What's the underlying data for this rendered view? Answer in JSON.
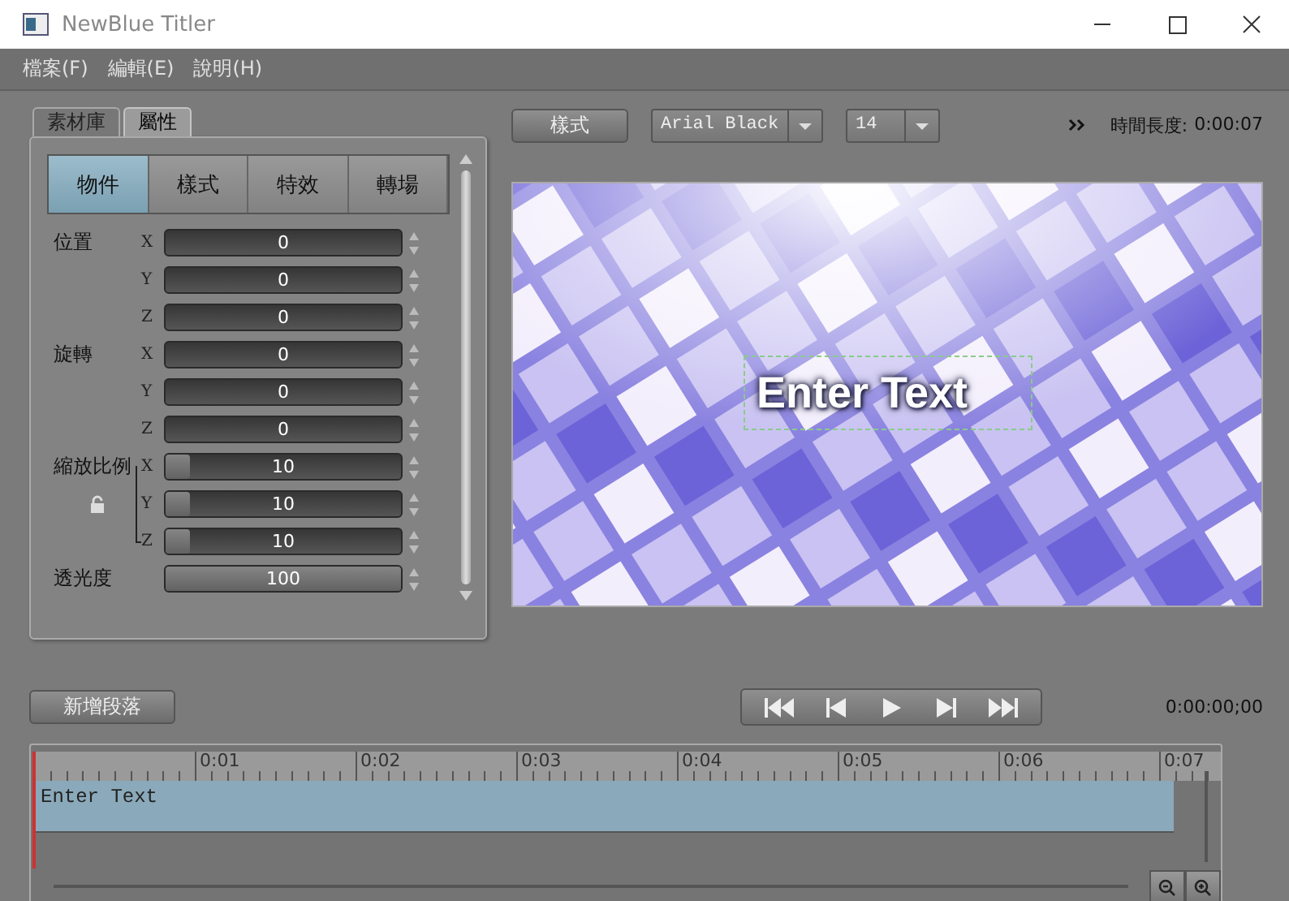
{
  "window": {
    "title": "NewBlue Titler"
  },
  "menu": [
    "檔案(F)",
    "編輯(E)",
    "說明(H)"
  ],
  "panel_tabs": [
    {
      "label": "素材庫",
      "selected": false
    },
    {
      "label": "屬性",
      "selected": true
    }
  ],
  "sub_tabs": [
    {
      "label": "物件",
      "selected": true
    },
    {
      "label": "樣式",
      "selected": false
    },
    {
      "label": "特效",
      "selected": false
    },
    {
      "label": "轉場",
      "selected": false
    }
  ],
  "groups": [
    {
      "label": "位置",
      "kind": "plain",
      "rows": [
        {
          "axis": "X",
          "value": "0",
          "kind": "spin"
        },
        {
          "axis": "Y",
          "value": "0",
          "kind": "spin"
        },
        {
          "axis": "Z",
          "value": "0",
          "kind": "spin"
        }
      ]
    },
    {
      "label": "旋轉",
      "kind": "plain",
      "rows": [
        {
          "axis": "X",
          "value": "0",
          "kind": "spin"
        },
        {
          "axis": "Y",
          "value": "0",
          "kind": "spin"
        },
        {
          "axis": "Z",
          "value": "0",
          "kind": "spin"
        }
      ]
    },
    {
      "label": "縮放比例",
      "kind": "linked",
      "rows": [
        {
          "axis": "X",
          "value": "10",
          "kind": "slider",
          "level": 0.1
        },
        {
          "axis": "Y",
          "value": "10",
          "kind": "slider",
          "level": 0.1
        },
        {
          "axis": "Z",
          "value": "10",
          "kind": "slider",
          "level": 0.1
        }
      ]
    },
    {
      "label": "透光度",
      "kind": "plain",
      "rows": [
        {
          "value": "100",
          "kind": "slider",
          "level": 1
        }
      ]
    }
  ],
  "toolbar": {
    "style_button": "樣式",
    "font": "Arial Black",
    "size": "14",
    "duration_label": "時間長度:",
    "duration": "0:00:07"
  },
  "preview": {
    "text": "Enter Text"
  },
  "add_paragraph_button": "新增段落",
  "timecode": "0:00:00;00",
  "timeline": {
    "ticks": [
      "0:01",
      "0:02",
      "0:03",
      "0:04",
      "0:05",
      "0:06",
      "0:07"
    ],
    "clip": "Enter Text"
  }
}
